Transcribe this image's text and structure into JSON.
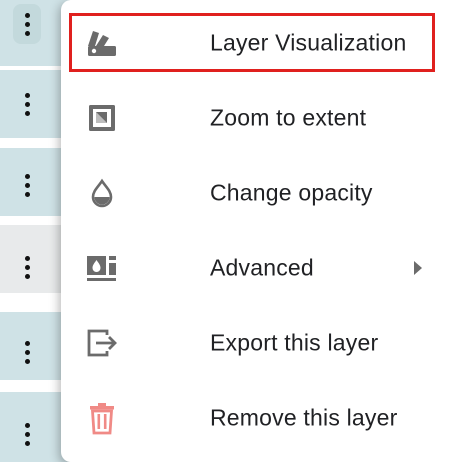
{
  "menu": {
    "items": [
      {
        "label": "Layer Visualization",
        "icon": "palette-icon",
        "highlighted": true
      },
      {
        "label": "Zoom to extent",
        "icon": "zoom-extent-icon"
      },
      {
        "label": "Change opacity",
        "icon": "opacity-drop-icon"
      },
      {
        "label": "Advanced",
        "icon": "advanced-layer-icon",
        "has_submenu": true
      },
      {
        "label": "Export this layer",
        "icon": "export-icon"
      },
      {
        "label": "Remove this layer",
        "icon": "trash-icon"
      }
    ]
  },
  "colors": {
    "highlight_border": "#e0201e",
    "icon_gray": "#6b6b6b",
    "trash_icon": "#f08a86",
    "layer_row_bg": "#cfe2e6",
    "layer_row_gray_bg": "#e8eaeb"
  }
}
